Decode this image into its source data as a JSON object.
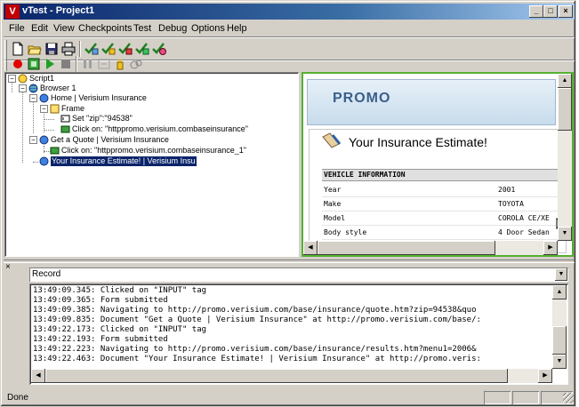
{
  "window": {
    "title": "vTest - Project1",
    "app_icon": "V"
  },
  "titlebar_buttons": {
    "minimize": "_",
    "maximize": "□",
    "close": "×"
  },
  "menu": [
    "File",
    "Edit",
    "View",
    "Checkpoints",
    "Test",
    "Debug",
    "Options",
    "Help"
  ],
  "tree": {
    "root": "Script1",
    "browser": "Browser 1",
    "home_page": "Home | Verisium Insurance",
    "frame": "Frame",
    "set_action": "Set \"zip\":\"94538\"",
    "click_action_1": "Click on: \"httppromo.verisium.combaseinsurance\"",
    "quote_page": "Get a Quote | Verisium Insurance",
    "click_action_2": "Click on: \"httppromo.verisium.combaseinsurance_1\"",
    "estimate_page": "Your Insurance Estimate! | Verisium Insu"
  },
  "browser": {
    "promo": "PROMO",
    "estimate_title": "Your Insurance Estimate!",
    "section_header": "VEHICLE INFORMATION",
    "rows": [
      {
        "key": "Year",
        "value": "2001"
      },
      {
        "key": "Make",
        "value": "TOYOTA"
      },
      {
        "key": "Model",
        "value": "COROLA CE/XE"
      },
      {
        "key": "Body style",
        "value": "4 Door Sedan"
      }
    ]
  },
  "log": {
    "selected": "Record",
    "lines": [
      "13:49:09.345: Clicked on \"INPUT\" tag",
      "13:49:09.365: Form submitted",
      "13:49:09.385: Navigating to http://promo.verisium.com/base/insurance/quote.htm?zip=94538&quo",
      "13:49:09.835: Document \"Get a Quote | Verisium Insurance\" at http://promo.verisium.com/base/:",
      "13:49:22.173: Clicked on \"INPUT\" tag",
      "13:49:22.193: Form submitted",
      "13:49:22.223: Navigating to http://promo.verisium.com/base/insurance/results.htm?menu1=2006&",
      "13:49:22.463: Document \"Your Insurance Estimate! | Verisium Insurance\" at http://promo.veris:"
    ]
  },
  "status": {
    "text": "Done"
  },
  "colors": {
    "title_start": "#0a246a",
    "title_end": "#a6caf0",
    "browser_border": "#55b030",
    "selection": "#0a246a"
  }
}
